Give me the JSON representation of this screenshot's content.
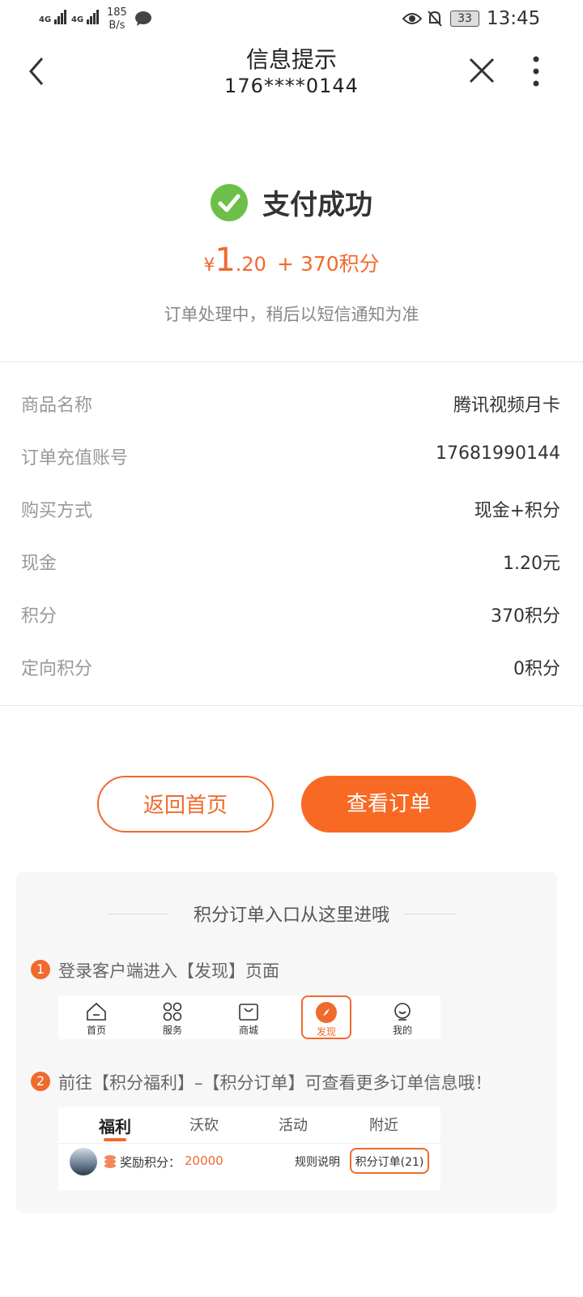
{
  "status_bar": {
    "net1": "4G",
    "net2": "4G",
    "speed": "185",
    "speed_unit": "B/s",
    "battery": "33",
    "time": "13:45"
  },
  "header": {
    "title": "信息提示",
    "subtitle": "176****0144"
  },
  "result": {
    "status": "支付成功",
    "currency": "¥",
    "amount_int": "1",
    "amount_dec": ".20",
    "points_text": "+ 370积分",
    "note": "订单处理中，稍后以短信通知为准"
  },
  "details": [
    {
      "label": "商品名称",
      "value": "腾讯视频月卡"
    },
    {
      "label": "订单充值账号",
      "value": "17681990144"
    },
    {
      "label": "购买方式",
      "value": "现金+积分"
    },
    {
      "label": "现金",
      "value": "1.20元"
    },
    {
      "label": "积分",
      "value": "370积分"
    },
    {
      "label": "定向积分",
      "value": "0积分"
    }
  ],
  "actions": {
    "home": "返回首页",
    "orders": "查看订单"
  },
  "guide": {
    "title": "积分订单入口从这里进哦",
    "step1": {
      "num": "1",
      "text": "登录客户端进入【发现】页面"
    },
    "step2": {
      "num": "2",
      "text": "前往【积分福利】–【积分订单】可查看更多订单信息哦！"
    },
    "tabbar": [
      {
        "label": "首页",
        "icon": "home-icon"
      },
      {
        "label": "服务",
        "icon": "grid-icon"
      },
      {
        "label": "商城",
        "icon": "bag-icon"
      },
      {
        "label": "发现",
        "icon": "compass-icon"
      },
      {
        "label": "我的",
        "icon": "profile-icon"
      }
    ],
    "welfare_tabs": [
      "福利",
      "沃砍",
      "活动",
      "附近"
    ],
    "points_label": "奖励积分：",
    "points_value": "20000",
    "rules": "规则说明",
    "orders_link": "积分订单(21)"
  },
  "colors": {
    "accent": "#f06a2c",
    "success": "#6cc04a"
  }
}
